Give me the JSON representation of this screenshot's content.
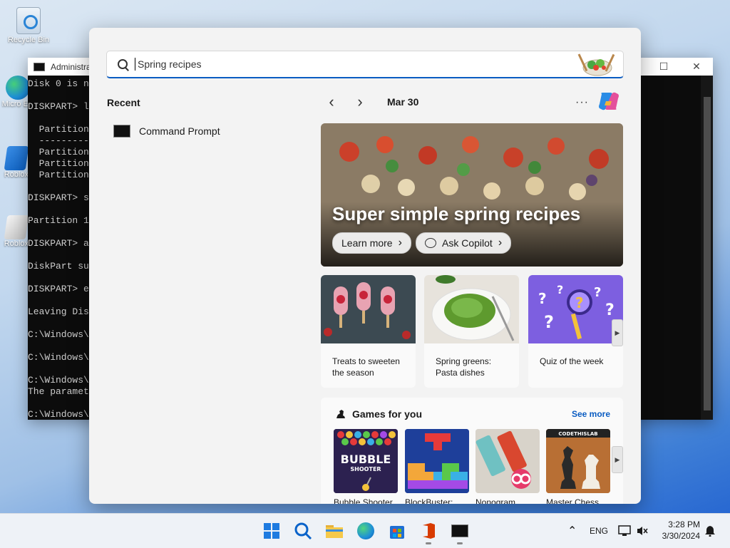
{
  "desktop": {
    "icons": [
      {
        "label": "Recycle Bin"
      },
      {
        "label": "Micro Ed"
      },
      {
        "label": "Roblox"
      },
      {
        "label": "Roblox"
      }
    ]
  },
  "cmd": {
    "title": "Administra",
    "lines": [
      "Disk 0 is n",
      "",
      "DISKPART> l",
      "",
      "  Partition",
      "  ---------",
      "  Partition",
      "  Partition",
      "  Partition",
      "",
      "DISKPART> s",
      "",
      "Partition 1",
      "",
      "DISKPART> a",
      "",
      "DiskPart su",
      "",
      "DISKPART> e",
      "",
      "Leaving Dis",
      "",
      "C:\\Windows\\",
      "",
      "C:\\Windows\\",
      "",
      "C:\\Windows\\",
      "The paramet",
      "",
      "C:\\Windows\\"
    ]
  },
  "search": {
    "value": "Spring recipes",
    "placeholder": "Spring recipes"
  },
  "recent": {
    "heading": "Recent",
    "items": [
      {
        "label": "Command Prompt",
        "icon": "cmd-icon"
      }
    ]
  },
  "feed": {
    "date": "Mar 30",
    "more_label": "···",
    "hero": {
      "title": "Super simple spring recipes",
      "learn_more": "Learn more",
      "ask_copilot": "Ask Copilot"
    },
    "cards": [
      {
        "caption": "Treats to sweeten the season"
      },
      {
        "caption": "Spring greens: Pasta dishes"
      },
      {
        "caption": "Quiz of the week"
      }
    ],
    "games": {
      "heading": "Games for you",
      "see_more": "See more",
      "items": [
        {
          "label": "Bubble Shooter",
          "art_text": "BUBBLE SHOOTER"
        },
        {
          "label": "BlockBuster:"
        },
        {
          "label": "Nonogram"
        },
        {
          "label": "Master Chess",
          "art_text": "CODETHISLAB"
        }
      ]
    }
  },
  "taskbar": {
    "language": "ENG",
    "time": "3:28 PM",
    "date": "3/30/2024"
  },
  "colors": {
    "accent": "#0a5cc2",
    "panel_bg": "#f3f3f3"
  }
}
